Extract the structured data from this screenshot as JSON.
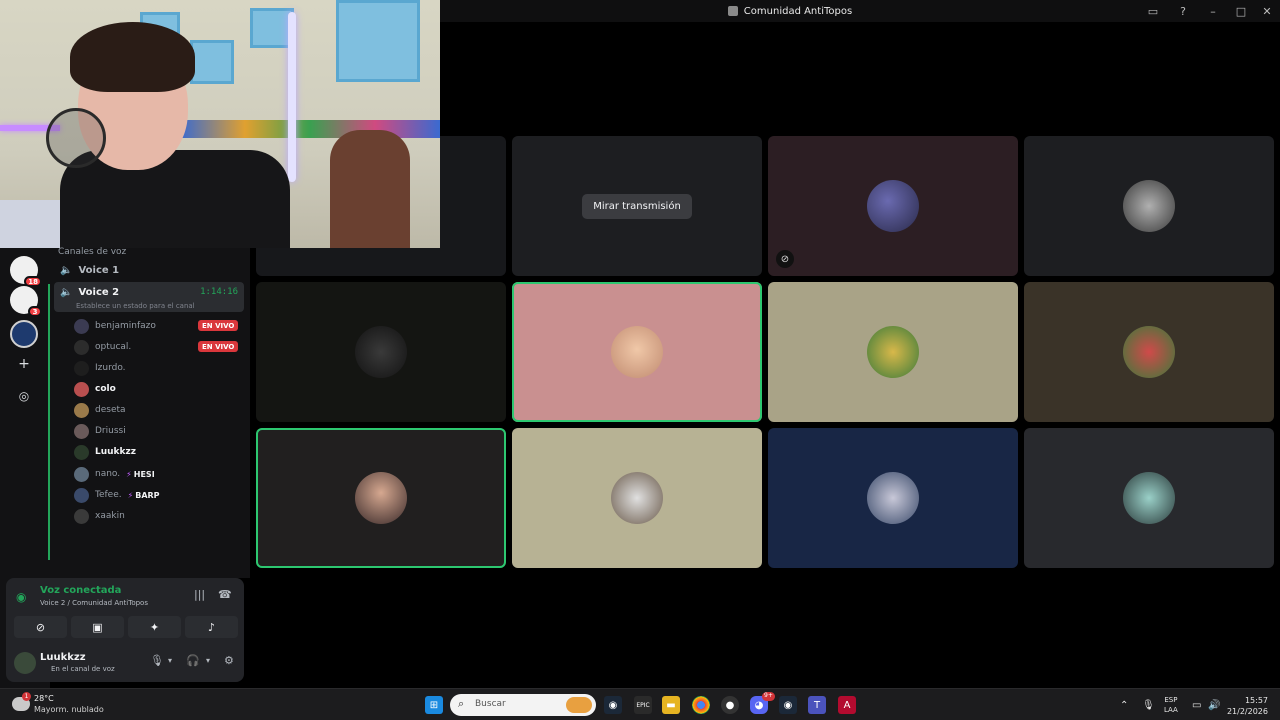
{
  "window": {
    "title": "Comunidad AntiTopos"
  },
  "servers": [
    {
      "label": "",
      "badge": "18"
    },
    {
      "label": "",
      "badge": "3"
    },
    {
      "label": "",
      "badge": ""
    }
  ],
  "channels": {
    "category": "Canales de voz",
    "voice1": "Voice 1",
    "voice2": "Voice 2",
    "voice2_timer": "1:14:16",
    "voice2_status": "Establece un estado para el canal",
    "members": [
      {
        "name": "benjaminfazo",
        "live": "EN VIVO",
        "color": "#3b3b52"
      },
      {
        "name": "optucal.",
        "live": "EN VIVO",
        "color": "#2c2c2c"
      },
      {
        "name": "Izurdo.",
        "color": "#1e1e1e"
      },
      {
        "name": "colo",
        "color": "#b94f4f"
      },
      {
        "name": "deseta",
        "color": "#9a7a4a"
      },
      {
        "name": "Driussi",
        "color": "#6a5a5a"
      },
      {
        "name": "Luukkzz",
        "color": "#2a3a2a"
      },
      {
        "name": "nano.",
        "tag": "HESI",
        "color": "#5a6a7a"
      },
      {
        "name": "Tefee.",
        "tag": "BARP",
        "color": "#3a4a6a"
      },
      {
        "name": "xaakin",
        "color": "#3a3a3a"
      }
    ]
  },
  "voice_panel": {
    "title": "Voz conectada",
    "subtitle": "Voice 2 / Comunidad AntiTopos"
  },
  "user": {
    "name": "Luukkzz",
    "status": "En el canal de voz"
  },
  "stage": {
    "watch_label": "Mirar transmisión"
  },
  "taskbar": {
    "temp": "28°C",
    "weather": "Mayorm. nublado",
    "weather_badge": "1",
    "search_placeholder": "Buscar",
    "lang_top": "ESP",
    "lang_bottom": "LAA",
    "time": "15:57",
    "date": "21/2/2026",
    "discord_badge": "9+"
  },
  "colors": {
    "accent_green": "#23a55a",
    "live_red": "#da373c",
    "speaking_border": "#2dc770"
  }
}
